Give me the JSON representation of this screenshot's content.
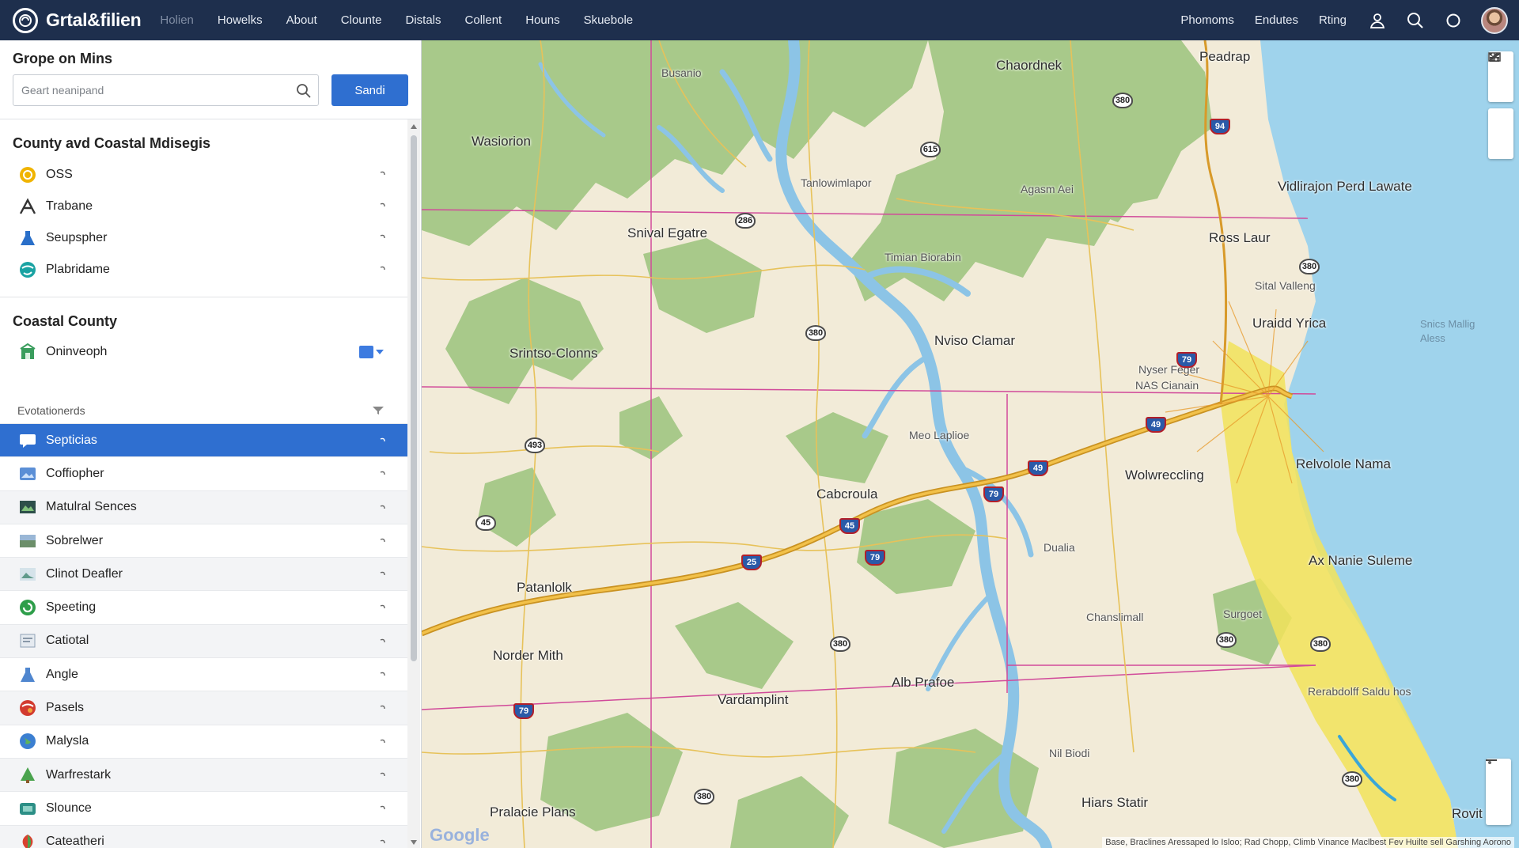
{
  "app": {
    "logo_icon": "globe-logo",
    "title": "Grtal&filien"
  },
  "nav": {
    "links": [
      "Holien",
      "Howelks",
      "About",
      "Clounte",
      "Distals",
      "Collent",
      "Houns",
      "Skuebole"
    ],
    "right_links": [
      "Phomoms",
      "Endutes",
      "Rting"
    ],
    "icons": [
      "user-icon",
      "search-icon",
      "circle-icon",
      "avatar"
    ]
  },
  "search": {
    "title": "Grope on Mins",
    "placeholder": "Geart neanipand",
    "button_label": "Sandi"
  },
  "section1": {
    "title": "County avd Coastal Mdisegis",
    "items": [
      {
        "label": "OSS",
        "icon": "coin-icon",
        "color": "#f0b400"
      },
      {
        "label": "Trabane",
        "icon": "hiker-icon",
        "color": "#333333"
      },
      {
        "label": "Seupspher",
        "icon": "flask-icon",
        "color": "#2a6fc9"
      },
      {
        "label": "Plabridame",
        "icon": "globe-icon",
        "color": "#1aa3a3"
      }
    ]
  },
  "section2": {
    "title": "Coastal County",
    "items": [
      {
        "label": "Oninveoph",
        "icon": "building-icon",
        "color": "#3a9d5d"
      }
    ]
  },
  "group": {
    "title": "Evotationerds",
    "items": [
      {
        "label": "Septicias",
        "icon": "chat-icon",
        "active": true
      },
      {
        "label": "Coffiopher",
        "icon": "image-icon",
        "active": false
      },
      {
        "label": "Matulral Sences",
        "icon": "photo-dark-icon",
        "active": false
      },
      {
        "label": "Sobrelwer",
        "icon": "landscape-icon",
        "active": false
      },
      {
        "label": "Clinot Deafler",
        "icon": "picture-icon",
        "active": false
      },
      {
        "label": "Speeting",
        "icon": "green-circle-icon",
        "active": false
      },
      {
        "label": "Catiotal",
        "icon": "document-icon",
        "active": false
      },
      {
        "label": "Angle",
        "icon": "flask-icon",
        "active": false
      },
      {
        "label": "Pasels",
        "icon": "red-globe-icon",
        "active": false
      },
      {
        "label": "Malysla",
        "icon": "earth-icon",
        "active": false
      },
      {
        "label": "Warfrestark",
        "icon": "tree-icon",
        "active": false
      },
      {
        "label": "Slounce",
        "icon": "teal-box-icon",
        "active": false
      },
      {
        "label": "Cateatheri",
        "icon": "leaf-icon",
        "active": false
      }
    ]
  },
  "map": {
    "labels": [
      {
        "text": "Busanio",
        "kind": "small"
      },
      {
        "text": "Chaordnek",
        "kind": "normal"
      },
      {
        "text": "Peadrap",
        "kind": "normal"
      },
      {
        "text": "Wasiorion",
        "kind": "normal"
      },
      {
        "text": "Tanlowimlapor",
        "kind": "small"
      },
      {
        "text": "Agasm Aei",
        "kind": "small"
      },
      {
        "text": "Vidlirajon Perd Lawate",
        "kind": "normal"
      },
      {
        "text": "Snival Egatre",
        "kind": "normal"
      },
      {
        "text": "Timian Biorabin",
        "kind": "small"
      },
      {
        "text": "Ross Laur",
        "kind": "normal"
      },
      {
        "text": "Sital Valleng",
        "kind": "small"
      },
      {
        "text": "Uraidd Yrica",
        "kind": "normal"
      },
      {
        "text": "Srintso-Clonns",
        "kind": "normal"
      },
      {
        "text": "Nviso Clamar",
        "kind": "normal"
      },
      {
        "text": "Nyser Feger",
        "kind": "small"
      },
      {
        "text": "NAS Cianain",
        "kind": "small"
      },
      {
        "text": "Meo Laplioe",
        "kind": "small"
      },
      {
        "text": "Cabcroula",
        "kind": "normal"
      },
      {
        "text": "Wolwreccling",
        "kind": "normal"
      },
      {
        "text": "Relvolole Nama",
        "kind": "normal"
      },
      {
        "text": "Dualia",
        "kind": "small"
      },
      {
        "text": "Ax Nanie Suleme",
        "kind": "normal"
      },
      {
        "text": "Patanlolk",
        "kind": "normal"
      },
      {
        "text": "Chanslimall",
        "kind": "small"
      },
      {
        "text": "Surgoet",
        "kind": "small"
      },
      {
        "text": "Norder Mith",
        "kind": "normal"
      },
      {
        "text": "Alb Prafoe",
        "kind": "normal"
      },
      {
        "text": "Vardamplint",
        "kind": "normal"
      },
      {
        "text": "Rerabdolff Saldu hos",
        "kind": "small"
      },
      {
        "text": "Nil Biodi",
        "kind": "small"
      },
      {
        "text": "Pralacie Plans",
        "kind": "normal"
      },
      {
        "text": "Hiars Statir",
        "kind": "normal"
      },
      {
        "text": "Rovit",
        "kind": "normal"
      },
      {
        "text": "Snics Mallig Aless",
        "kind": "water"
      }
    ],
    "shields": [
      "615",
      "286",
      "380",
      "493",
      "45",
      "94",
      "79",
      "49",
      "49",
      "45",
      "79",
      "25",
      "79",
      "380",
      "380",
      "380",
      "380",
      "380",
      "380",
      "79",
      "380"
    ],
    "google_logo": "Google",
    "attribution": "Base, Braclines Aressaped lo Isloo; Rad Chopp, Climb Vinance Maclbest Fev Huilte sell Garshing Aorono"
  },
  "colors": {
    "topbar": "#1e2f4d",
    "accent": "#2f6fd0",
    "land": "#f2ebd8",
    "forest": "#a8c98a",
    "water": "#8cc4e6",
    "ocean": "#9fd3ec",
    "highway": "#e0a82e",
    "urban": "#f2e35a",
    "boundary": "#d14a9a"
  }
}
